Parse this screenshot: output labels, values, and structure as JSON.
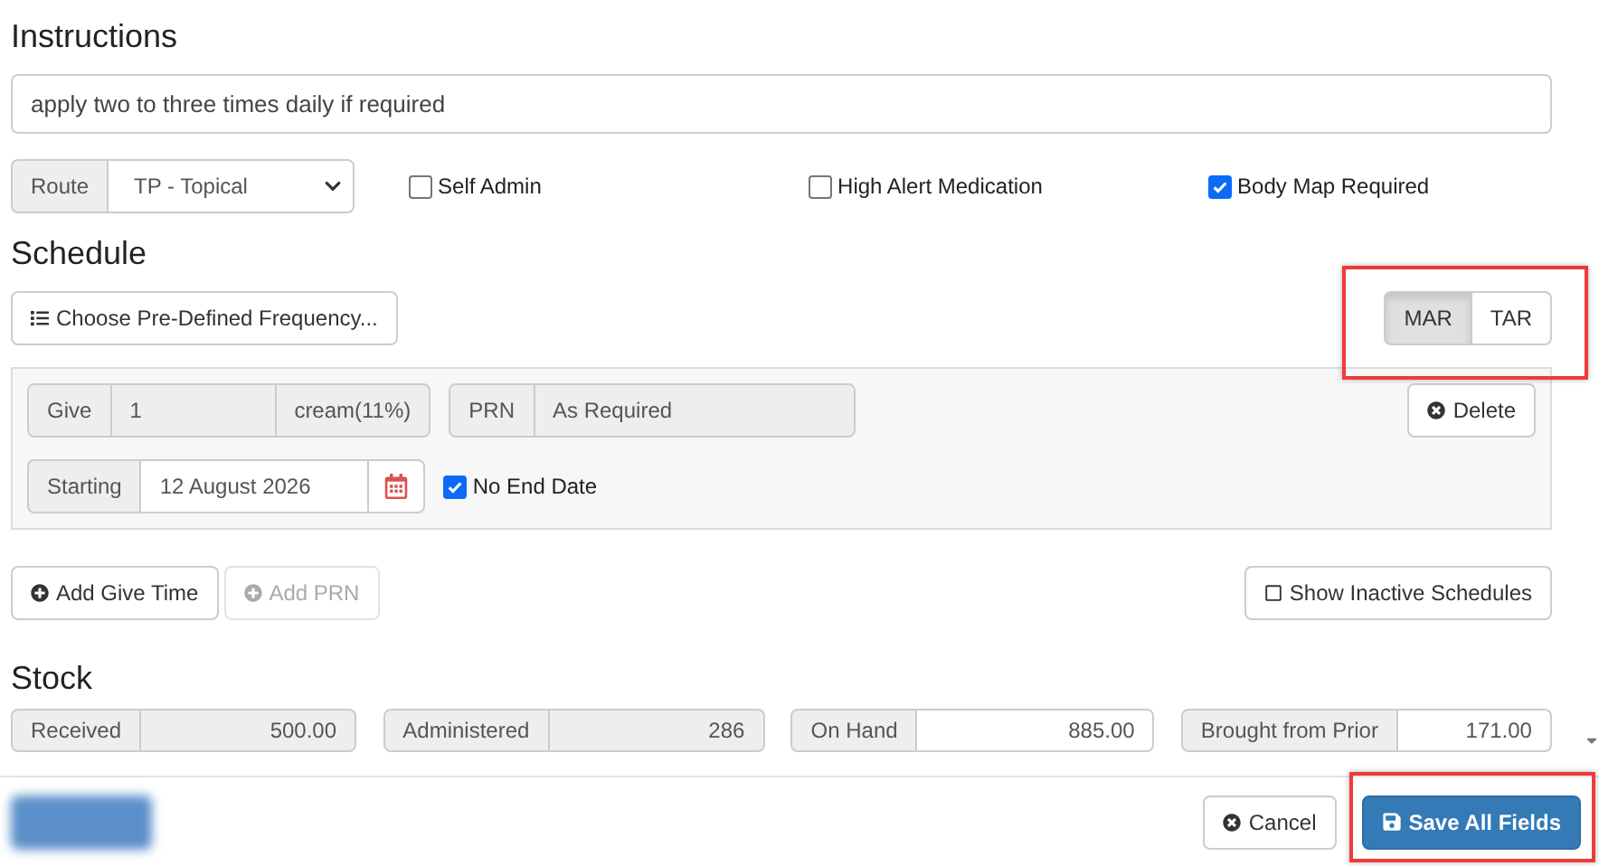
{
  "instructions": {
    "heading": "Instructions",
    "value": "apply two to three times daily if required"
  },
  "route": {
    "label": "Route",
    "value": "TP - Topical"
  },
  "flags": [
    {
      "label": "Self Admin",
      "checked": false
    },
    {
      "label": "High Alert Medication",
      "checked": false
    },
    {
      "label": "Body Map Required",
      "checked": true
    }
  ],
  "schedule": {
    "heading": "Schedule",
    "frequency_button": "Choose Pre-Defined Frequency...",
    "modes": [
      {
        "label": "MAR",
        "selected": true
      },
      {
        "label": "TAR",
        "selected": false
      }
    ],
    "give": {
      "label": "Give",
      "value": "1",
      "unit": "cream(11%)"
    },
    "prn": {
      "label": "PRN",
      "value": "As Required"
    },
    "delete_button": "Delete",
    "starting": {
      "label": "Starting",
      "value": "12 August 2026"
    },
    "no_end_date": {
      "label": "No End Date",
      "checked": true
    },
    "actions": [
      {
        "label": "Add Give Time",
        "disabled": false
      },
      {
        "label": "Add PRN",
        "disabled": true
      }
    ],
    "show_inactive": "Show Inactive Schedules"
  },
  "stock": {
    "heading": "Stock",
    "fields": [
      {
        "label": "Received",
        "value": "500.00",
        "kind": "readonly"
      },
      {
        "label": "Administered",
        "value": "286",
        "kind": "readonly"
      },
      {
        "label": "On Hand",
        "value": "885.00",
        "kind": "input"
      },
      {
        "label": "Brought from Prior",
        "value": "171.00",
        "kind": "input"
      }
    ]
  },
  "footer": {
    "cancel": "Cancel",
    "save": "Save All Fields"
  }
}
